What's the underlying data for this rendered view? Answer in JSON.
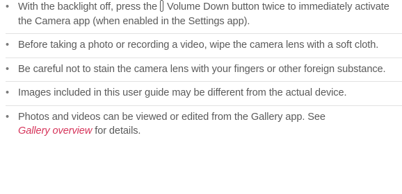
{
  "bullets": [
    {
      "part1": "With the backlight off, press the",
      "icon": "volume-down-key-icon",
      "part2": "Volume Down button twice to immediately activate the Camera app (when enabled in the Settings app)."
    },
    {
      "text": "Before taking a photo or recording a video, wipe the camera lens with a soft cloth."
    },
    {
      "text": "Be careful not to stain the camera lens with your fingers or other foreign substance."
    },
    {
      "text": "Images included in this user guide may be different from the actual device."
    },
    {
      "text_before": "Photos and videos can be viewed or edited from the Gallery app. See",
      "link": "Gallery overview",
      "text_after": "for details."
    }
  ],
  "colors": {
    "text": "#5a5a5a",
    "link": "#d6345a",
    "divider": "#e2e2e2"
  }
}
